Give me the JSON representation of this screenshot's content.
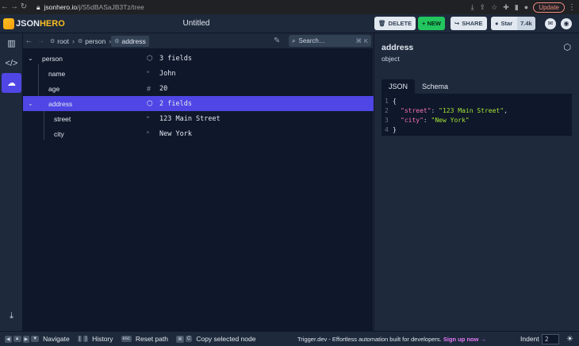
{
  "browser": {
    "url_host": "jsonhero.io",
    "url_path": "/j/S5dBASaJB3Tz/tree",
    "update_label": "Update"
  },
  "header": {
    "logo_a": "JSON",
    "logo_b": "HERO",
    "doc_title": "Untitled",
    "delete_label": "DELETE",
    "new_label": "+ NEW",
    "share_label": "SHARE",
    "star_label": "Star",
    "star_count": "7.4k"
  },
  "pathbar": {
    "crumbs": [
      "root",
      "person",
      "address"
    ],
    "search_placeholder": "Search…",
    "kbd_a": "⌘",
    "kbd_b": "K"
  },
  "tree": {
    "rows": [
      {
        "key": "person",
        "icon": "cube-icon",
        "value": "3 fields"
      },
      {
        "key": "name",
        "icon": "quote-icon",
        "value": "John"
      },
      {
        "key": "age",
        "icon": "hash-icon",
        "value": "20"
      },
      {
        "key": "address",
        "icon": "cube-icon",
        "value": "2 fields"
      },
      {
        "key": "street",
        "icon": "quote-icon",
        "value": "123 Main Street"
      },
      {
        "key": "city",
        "icon": "quote-icon",
        "value": "New York"
      }
    ]
  },
  "detail": {
    "title": "address",
    "type": "object",
    "tabs": [
      "JSON",
      "Schema"
    ],
    "code": {
      "l1": "{",
      "k1": "\"street\"",
      "v1": "\"123 Main Street\"",
      "k2": "\"city\"",
      "v2": "\"New York\"",
      "l4": "}"
    }
  },
  "footer": {
    "navigate": "Navigate",
    "history": "History",
    "reset": "Reset path",
    "copy": "Copy selected node",
    "promo_text": "Trigger.dev - Effortless automation built for developers.",
    "promo_cta": "Sign up now →",
    "indent_label": "Indent",
    "indent_value": "2"
  },
  "colors": {
    "accent": "#4f46e5",
    "new_button": "#22c55e",
    "panel": "#1e293b",
    "background": "#0f172a"
  }
}
